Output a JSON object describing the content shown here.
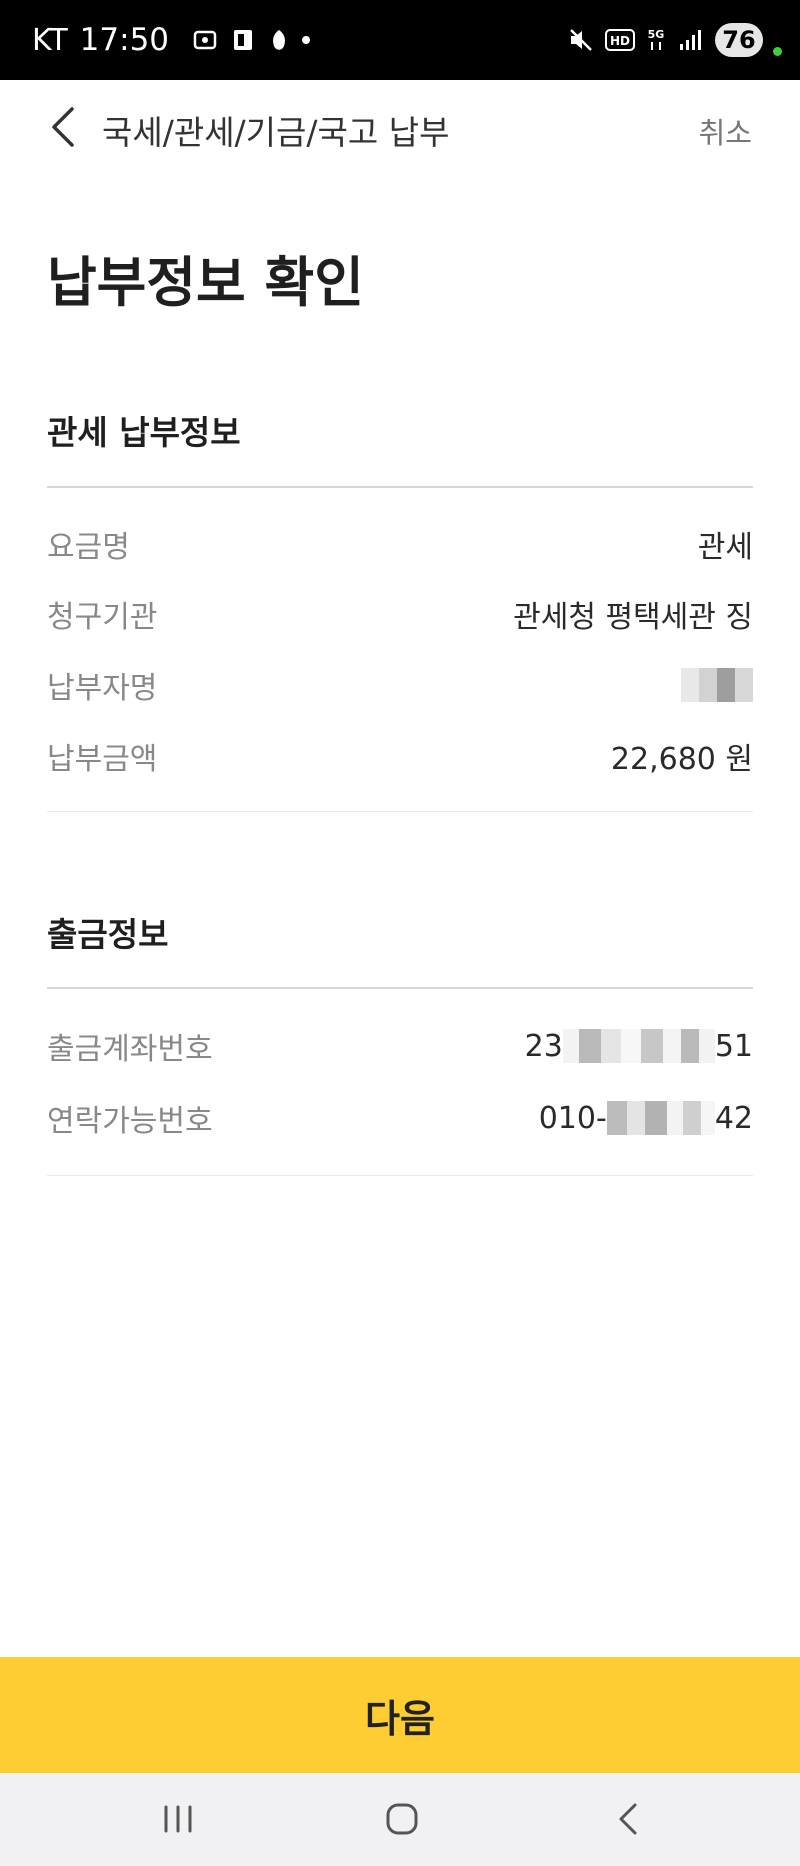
{
  "status_bar": {
    "carrier": "KT",
    "time": "17:50",
    "battery": "76"
  },
  "header": {
    "title": "국세/관세/기금/국고 납부",
    "cancel_label": "취소"
  },
  "page_title": "납부정보 확인",
  "payment_info": {
    "section_title": "관세 납부정보",
    "rows": [
      {
        "label": "요금명",
        "value": "관세"
      },
      {
        "label": "청구기관",
        "value": "관세청 평택세관 징"
      },
      {
        "label": "납부자명",
        "value": ""
      },
      {
        "label": "납부금액",
        "value": "22,680 원"
      }
    ]
  },
  "withdrawal_info": {
    "section_title": "출금정보",
    "rows": [
      {
        "label": "출금계좌번호",
        "value_prefix": "23",
        "value_suffix": "51"
      },
      {
        "label": "연락가능번호",
        "value_prefix": "010-",
        "value_suffix": "42"
      }
    ]
  },
  "next_button_label": "다음",
  "colors": {
    "accent": "#fecd32",
    "status_bar_bg": "#000000",
    "nav_bar_bg": "#f1f1f3"
  },
  "icons": [
    "back-chevron-icon",
    "recents-icon",
    "home-icon",
    "nav-back-icon"
  ]
}
